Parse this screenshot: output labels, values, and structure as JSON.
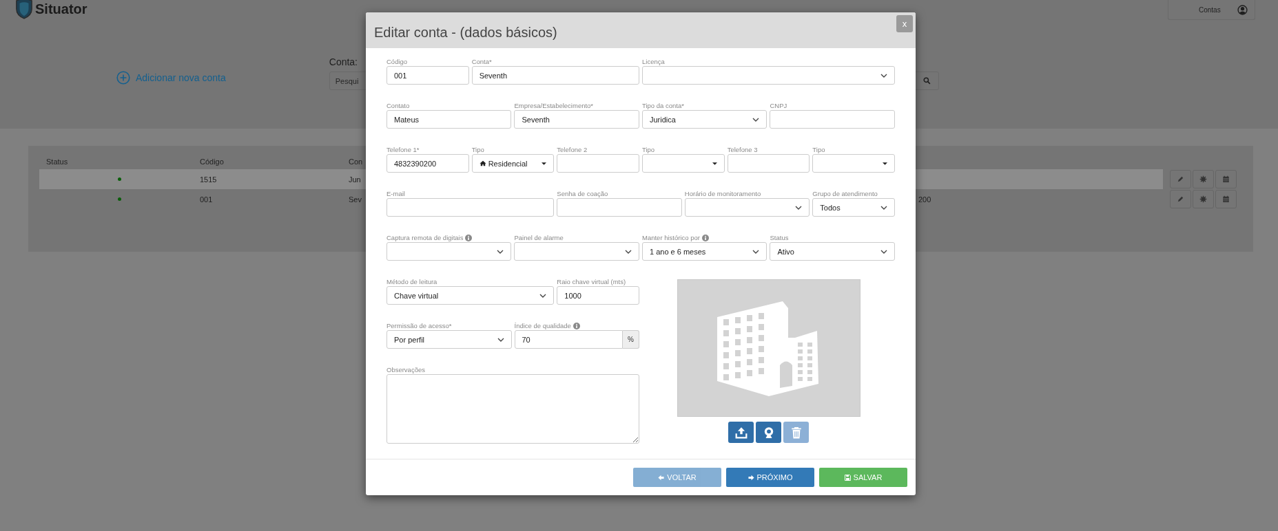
{
  "header": {
    "logo": "Situator",
    "menu": {
      "label": "Contas"
    }
  },
  "toolbar": {
    "add_link": "Adicionar nova conta",
    "search_label": "Conta:",
    "search_placeholder": "Pesqui"
  },
  "table": {
    "columns": [
      "Status",
      "Código",
      "Con"
    ],
    "rows": [
      {
        "selected": true,
        "color": "#0b5e0b",
        "code": "1515",
        "column_3": "Jun"
      },
      {
        "selected": false,
        "color": "#0b5e0b",
        "code": "001",
        "column_3": "Sev",
        "column_4": "200"
      }
    ]
  },
  "modal": {
    "title": "Editar conta - (dados básicos)",
    "close": "x",
    "fields": [
      {
        "kind": "text",
        "label": "Código",
        "value": "001",
        "info": false
      },
      {
        "kind": "text",
        "label": "Conta*",
        "value": "Seventh",
        "info": false
      },
      {
        "kind": "select",
        "label": "Licença",
        "info": false
      },
      {
        "kind": "text",
        "label": "Contato",
        "value": "Mateus",
        "info": false
      },
      {
        "kind": "text",
        "label": "Empresa/Estabelecimento*",
        "value": "Seventh",
        "info": false
      },
      {
        "kind": "select",
        "label": "Tipo da conta*",
        "value": "Juridica",
        "info": false
      },
      {
        "kind": "text",
        "label": "CNPJ",
        "info": false
      },
      {
        "kind": "text",
        "label": "Telefone 1*",
        "value": "4832390200",
        "info": false
      },
      {
        "kind": "dropdown",
        "label": "Tipo",
        "value": "Residencial",
        "has_icon": true,
        "info": false
      },
      {
        "kind": "text",
        "label": "Telefone 2",
        "info": false
      },
      {
        "kind": "dropdown",
        "label": "Tipo",
        "has_icon": false,
        "info": false
      },
      {
        "kind": "text",
        "label": "Telefone 3",
        "info": false
      },
      {
        "kind": "dropdown",
        "label": "Tipo",
        "has_icon": false,
        "info": false
      },
      {
        "kind": "text",
        "label": "E-mail",
        "info": false
      },
      {
        "kind": "text",
        "label": "Senha de coação",
        "info": false
      },
      {
        "kind": "select",
        "label": "Horário de monitoramento",
        "info": false
      },
      {
        "kind": "select",
        "label": "Grupo de atendimento",
        "value": "Todos",
        "info": false
      },
      {
        "kind": "select",
        "label": "Captura remota de digitais",
        "info": true
      },
      {
        "kind": "select",
        "label": "Painel de alarme",
        "info": false
      },
      {
        "kind": "select",
        "label": "Manter histórico por",
        "value": "1 ano e 6 meses",
        "info": true
      },
      {
        "kind": "select",
        "label": "Status",
        "value": "Ativo",
        "info": false
      }
    ],
    "lower_fields": [
      {
        "kind": "select",
        "label": "Método de leitura",
        "value": "Chave virtual",
        "info": false
      },
      {
        "kind": "text",
        "label": "Raio chave virtual (mts)",
        "value": "1000",
        "info": false
      },
      {
        "kind": "select",
        "label": "Permissão de acesso*",
        "value": "Por perfil",
        "info": false
      },
      {
        "kind": "input_group",
        "label": "Índice de qualidade",
        "value": "70",
        "addon": "%",
        "info": true
      },
      {
        "kind": "textarea",
        "label": "Observações",
        "info": false
      }
    ],
    "photo_buttons": [
      {
        "kind": "upload",
        "disabled": false
      },
      {
        "kind": "webcam",
        "disabled": false
      },
      {
        "kind": "delete",
        "disabled": true
      }
    ],
    "footer_buttons": [
      {
        "kind": "back",
        "label": "VOLTAR",
        "disabled": true
      },
      {
        "kind": "next",
        "label": "PRÓXIMO",
        "disabled": false
      },
      {
        "kind": "save",
        "label": "SALVAR",
        "disabled": false
      }
    ]
  }
}
